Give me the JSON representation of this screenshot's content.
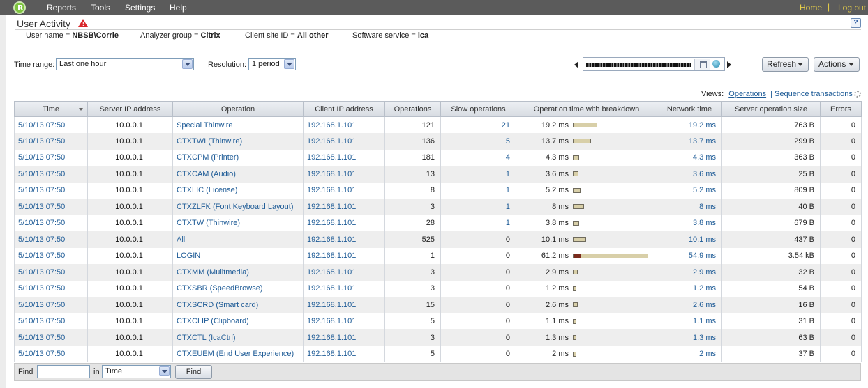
{
  "menu": {
    "logo_letter": "R",
    "items": [
      "Reports",
      "Tools",
      "Settings",
      "Help"
    ],
    "home": "Home",
    "separator": "|",
    "logout": "Log out"
  },
  "page": {
    "title": "User Activity",
    "help": "?"
  },
  "criteria": [
    {
      "label": "User name = ",
      "value": "NBSB\\Corrie"
    },
    {
      "label": "Analyzer group = ",
      "value": "Citrix"
    },
    {
      "label": "Client site ID = ",
      "value": "All other"
    },
    {
      "label": "Software service = ",
      "value": "ica"
    }
  ],
  "controls": {
    "time_range_label": "Time range:",
    "time_range_value": "Last one hour",
    "resolution_label": "Resolution:",
    "resolution_value": "1 period",
    "refresh": "Refresh",
    "actions": "Actions"
  },
  "views": {
    "label": "Views:",
    "operations": "Operations",
    "sep": "|",
    "sequence": "Sequence transactions"
  },
  "table": {
    "headers": [
      "Time",
      "Server IP address",
      "Operation",
      "Client IP address",
      "Operations",
      "Slow operations",
      "Operation time with breakdown",
      "Network time",
      "Server operation size",
      "Errors"
    ],
    "rows": [
      {
        "time": "5/10/13 07:50",
        "server_ip": "10.0.0.1",
        "operation": "Special Thinwire",
        "client_ip": "192.168.1.101",
        "operations": "121",
        "slow": "21",
        "op_time": "19.2 ms",
        "op_time_ms": 19.2,
        "server_time_ms": 0,
        "net_time": "19.2 ms",
        "size": "763 B",
        "errors": "0"
      },
      {
        "time": "5/10/13 07:50",
        "server_ip": "10.0.0.1",
        "operation": "CTXTWI (Thinwire)",
        "client_ip": "192.168.1.101",
        "operations": "136",
        "slow": "5",
        "op_time": "13.7 ms",
        "op_time_ms": 13.7,
        "server_time_ms": 0,
        "net_time": "13.7 ms",
        "size": "299 B",
        "errors": "0"
      },
      {
        "time": "5/10/13 07:50",
        "server_ip": "10.0.0.1",
        "operation": "CTXCPM (Printer)",
        "client_ip": "192.168.1.101",
        "operations": "181",
        "slow": "4",
        "op_time": "4.3 ms",
        "op_time_ms": 4.3,
        "server_time_ms": 0,
        "net_time": "4.3 ms",
        "size": "363 B",
        "errors": "0"
      },
      {
        "time": "5/10/13 07:50",
        "server_ip": "10.0.0.1",
        "operation": "CTXCAM (Audio)",
        "client_ip": "192.168.1.101",
        "operations": "13",
        "slow": "1",
        "op_time": "3.6 ms",
        "op_time_ms": 3.6,
        "server_time_ms": 0,
        "net_time": "3.6 ms",
        "size": "25 B",
        "errors": "0"
      },
      {
        "time": "5/10/13 07:50",
        "server_ip": "10.0.0.1",
        "operation": "CTXLIC (License)",
        "client_ip": "192.168.1.101",
        "operations": "8",
        "slow": "1",
        "op_time": "5.2 ms",
        "op_time_ms": 5.2,
        "server_time_ms": 0,
        "net_time": "5.2 ms",
        "size": "809 B",
        "errors": "0"
      },
      {
        "time": "5/10/13 07:50",
        "server_ip": "10.0.0.1",
        "operation": "CTXZLFK (Font Keyboard Layout)",
        "client_ip": "192.168.1.101",
        "operations": "3",
        "slow": "1",
        "op_time": "8 ms",
        "op_time_ms": 8,
        "server_time_ms": 0,
        "net_time": "8 ms",
        "size": "40 B",
        "errors": "0"
      },
      {
        "time": "5/10/13 07:50",
        "server_ip": "10.0.0.1",
        "operation": "CTXTW (Thinwire)",
        "client_ip": "192.168.1.101",
        "operations": "28",
        "slow": "1",
        "op_time": "3.8 ms",
        "op_time_ms": 3.8,
        "server_time_ms": 0,
        "net_time": "3.8 ms",
        "size": "679 B",
        "errors": "0"
      },
      {
        "time": "5/10/13 07:50",
        "server_ip": "10.0.0.1",
        "operation": "All",
        "client_ip": "192.168.1.101",
        "operations": "525",
        "slow": "0",
        "op_time": "10.1 ms",
        "op_time_ms": 10.1,
        "server_time_ms": 0,
        "net_time": "10.1 ms",
        "size": "437 B",
        "errors": "0"
      },
      {
        "time": "5/10/13 07:50",
        "server_ip": "10.0.0.1",
        "operation": "LOGIN",
        "client_ip": "192.168.1.101",
        "operations": "1",
        "slow": "0",
        "op_time": "61.2 ms",
        "op_time_ms": 61.2,
        "server_time_ms": 6.3,
        "net_time": "54.9 ms",
        "size": "3.54 kB",
        "errors": "0"
      },
      {
        "time": "5/10/13 07:50",
        "server_ip": "10.0.0.1",
        "operation": "CTXMM (Mulitmedia)",
        "client_ip": "192.168.1.101",
        "operations": "3",
        "slow": "0",
        "op_time": "2.9 ms",
        "op_time_ms": 2.9,
        "server_time_ms": 0,
        "net_time": "2.9 ms",
        "size": "32 B",
        "errors": "0"
      },
      {
        "time": "5/10/13 07:50",
        "server_ip": "10.0.0.1",
        "operation": "CTXSBR (SpeedBrowse)",
        "client_ip": "192.168.1.101",
        "operations": "3",
        "slow": "0",
        "op_time": "1.2 ms",
        "op_time_ms": 1.2,
        "server_time_ms": 0,
        "net_time": "1.2 ms",
        "size": "54 B",
        "errors": "0"
      },
      {
        "time": "5/10/13 07:50",
        "server_ip": "10.0.0.1",
        "operation": "CTXSCRD (Smart card)",
        "client_ip": "192.168.1.101",
        "operations": "15",
        "slow": "0",
        "op_time": "2.6 ms",
        "op_time_ms": 2.6,
        "server_time_ms": 0,
        "net_time": "2.6 ms",
        "size": "16 B",
        "errors": "0"
      },
      {
        "time": "5/10/13 07:50",
        "server_ip": "10.0.0.1",
        "operation": "CTXCLIP (Clipboard)",
        "client_ip": "192.168.1.101",
        "operations": "5",
        "slow": "0",
        "op_time": "1.1 ms",
        "op_time_ms": 1.1,
        "server_time_ms": 0,
        "net_time": "1.1 ms",
        "size": "31 B",
        "errors": "0"
      },
      {
        "time": "5/10/13 07:50",
        "server_ip": "10.0.0.1",
        "operation": "CTXCTL (IcaCtrl)",
        "client_ip": "192.168.1.101",
        "operations": "3",
        "slow": "0",
        "op_time": "1.3 ms",
        "op_time_ms": 1.3,
        "server_time_ms": 0,
        "net_time": "1.3 ms",
        "size": "63 B",
        "errors": "0"
      },
      {
        "time": "5/10/13 07:50",
        "server_ip": "10.0.0.1",
        "operation": "CTXEUEM (End User Experience)",
        "client_ip": "192.168.1.101",
        "operations": "5",
        "slow": "0",
        "op_time": "2 ms",
        "op_time_ms": 2,
        "server_time_ms": 0,
        "net_time": "2 ms",
        "size": "37 B",
        "errors": "0"
      }
    ]
  },
  "footer": {
    "find_label": "Find",
    "find_value": "",
    "in_label": "in",
    "in_value": "Time",
    "find_button": "Find"
  },
  "colors": {
    "menubar": "#5b5b5b",
    "link": "#1f5c97",
    "toplink": "#e8d04a",
    "bar_network": "#d8cfa8",
    "bar_server": "#7a2a1c"
  },
  "icons": [
    "logo-icon",
    "warning-icon",
    "help-icon",
    "calendar-icon",
    "go-icon",
    "prev-arrow-icon",
    "next-arrow-icon",
    "gear-icon"
  ]
}
